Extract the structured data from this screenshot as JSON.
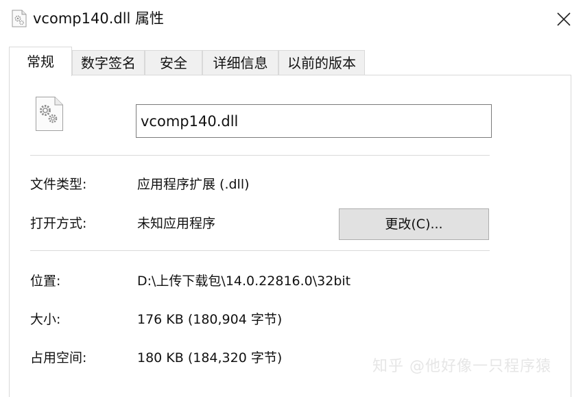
{
  "window": {
    "title": "vcomp140.dll 属性",
    "icon": "dll-file-icon",
    "close_icon": "close-icon"
  },
  "tabs": [
    {
      "label": "常规",
      "active": true
    },
    {
      "label": "数字签名",
      "active": false
    },
    {
      "label": "安全",
      "active": false
    },
    {
      "label": "详细信息",
      "active": false
    },
    {
      "label": "以前的版本",
      "active": false
    }
  ],
  "general": {
    "file_name": "vcomp140.dll",
    "file_type": {
      "label": "文件类型:",
      "value": "应用程序扩展 (.dll)"
    },
    "opens_with": {
      "label": "打开方式:",
      "value": "未知应用程序",
      "change_button": "更改(C)..."
    },
    "location": {
      "label": "位置:",
      "value": "D:\\上传下载包\\14.0.22816.0\\32bit"
    },
    "size": {
      "label": "大小:",
      "value": "176 KB (180,904 字节)"
    },
    "size_on_disk": {
      "label": "占用空间:",
      "value": "180 KB (184,320 字节)"
    }
  },
  "watermark": "知乎 @他好像一只程序猿"
}
